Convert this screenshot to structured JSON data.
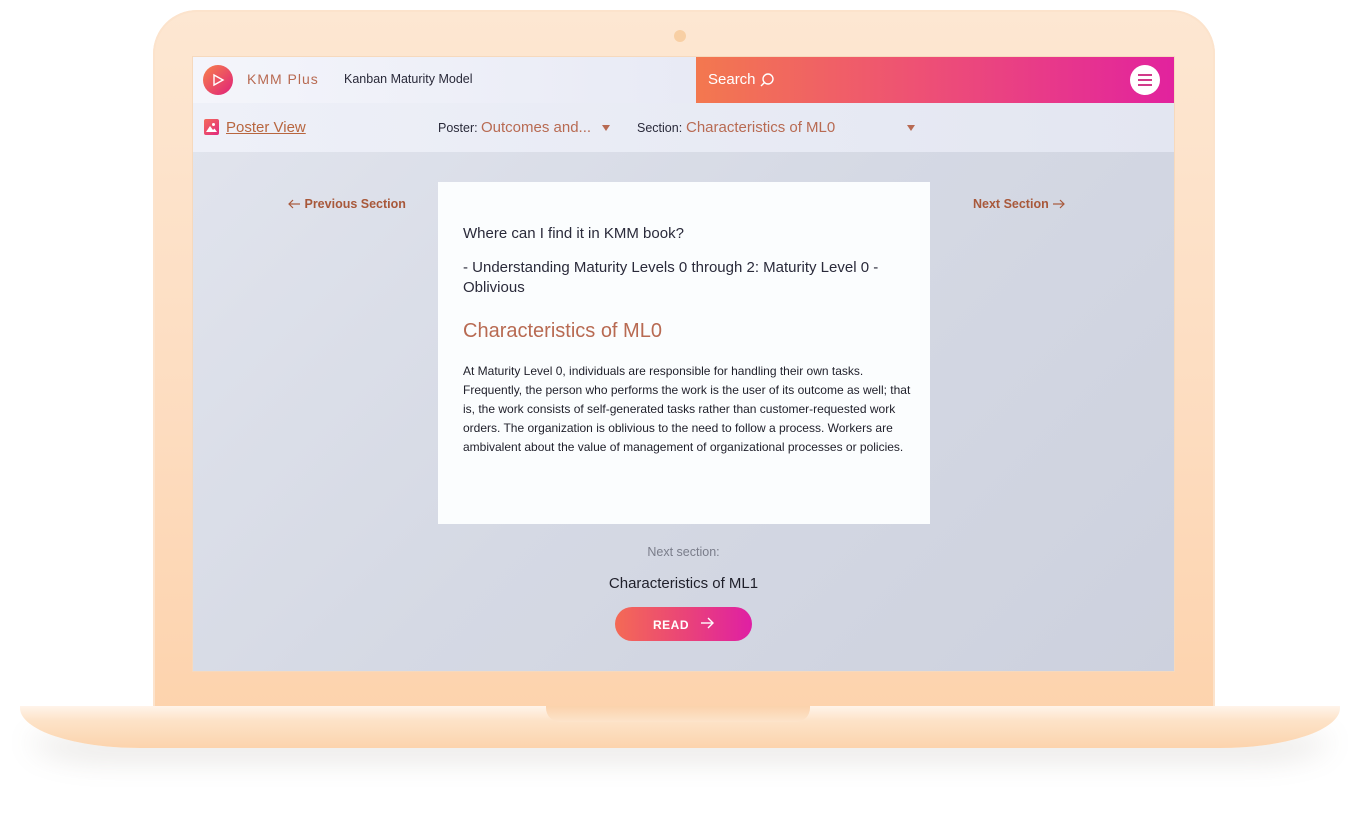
{
  "app": {
    "brand": "KMM Plus",
    "subtitle": "Kanban Maturity Model"
  },
  "search": {
    "label": "Search"
  },
  "toolbar": {
    "poster_view_label": "Poster View",
    "poster_label": "Poster:",
    "poster_value": "Outcomes and...",
    "section_label": "Section:",
    "section_value": "Characteristics of ML0"
  },
  "nav": {
    "previous": "Previous Section",
    "next": "Next Section"
  },
  "card": {
    "question": "Where can I find it in KMM book?",
    "reference": "- Understanding Maturity Levels 0 through 2: Maturity Level 0 - Oblivious",
    "title": "Characteristics of ML0",
    "body": "At Maturity Level 0, individuals are responsible for handling their own tasks. Frequently, the person who performs the work is the user of its outcome as well; that is, the work consists of self-generated tasks rather than customer-requested work orders. The organization is oblivious to the need to follow a process. Workers are ambivalent about the value of management of organizational processes or policies."
  },
  "next_section": {
    "label": "Next section:",
    "title": "Characteristics of ML1",
    "button": "READ"
  },
  "icons": {
    "logo": "play-logo-icon",
    "search": "search-icon",
    "menu": "hamburger-menu-icon",
    "poster": "image-icon",
    "caret": "caret-down-icon",
    "arrow_left": "arrow-left-icon",
    "arrow_right": "arrow-right-icon"
  },
  "colors": {
    "accent": "#b86a52",
    "gradient_start": "#f3784f",
    "gradient_end": "#e2229e",
    "laptop": "#fddcbf"
  }
}
